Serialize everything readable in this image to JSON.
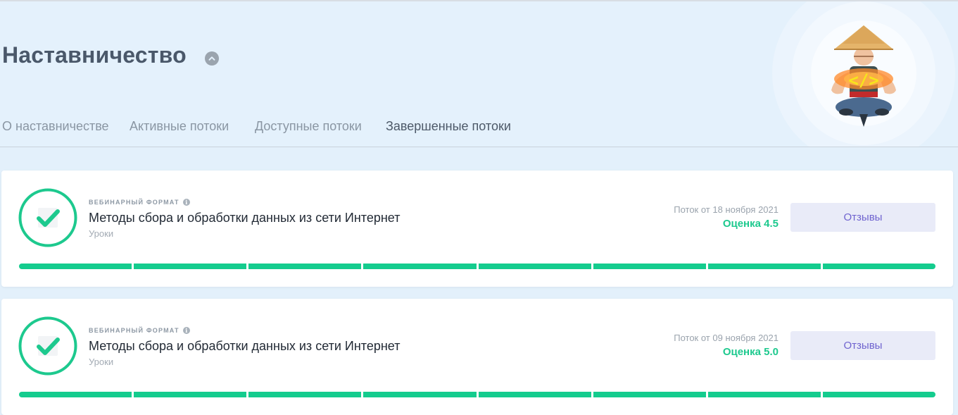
{
  "header": {
    "title": "Наставничество",
    "toggle_icon": "chevron-up-icon",
    "mascot_icon": "coder-mascot"
  },
  "tabs": [
    {
      "label": "О наставничестве",
      "active": false
    },
    {
      "label": "Активные потоки",
      "active": false
    },
    {
      "label": "Доступные потоки",
      "active": false
    },
    {
      "label": "Завершенные потоки",
      "active": true
    }
  ],
  "courses": [
    {
      "format": "ВЕБИНАРНЫЙ ФОРМАТ",
      "title": "Методы сбора и обработки данных из сети Интернет",
      "subtitle": "Уроки",
      "stream_date": "Поток от 18 ноября 2021",
      "rating": "Оценка 4.5",
      "button": "Отзывы",
      "status_icon": "check-icon",
      "progress_segments_completed": 8,
      "progress_segments_total": 8
    },
    {
      "format": "ВЕБИНАРНЫЙ ФОРМАТ",
      "title": "Методы сбора и обработки данных из сети Интернет",
      "subtitle": "Уроки",
      "stream_date": "Поток от 09 ноября 2021",
      "rating": "Оценка 5.0",
      "button": "Отзывы",
      "status_icon": "check-icon",
      "progress_segments_completed": 8,
      "progress_segments_total": 8
    }
  ],
  "colors": {
    "accent_green": "#14cc8e",
    "button_text": "#6f63cf",
    "button_bg": "#e9ebf8",
    "header_bg": "#e4f1fc",
    "active_tab_underline": "#4b5a70"
  }
}
